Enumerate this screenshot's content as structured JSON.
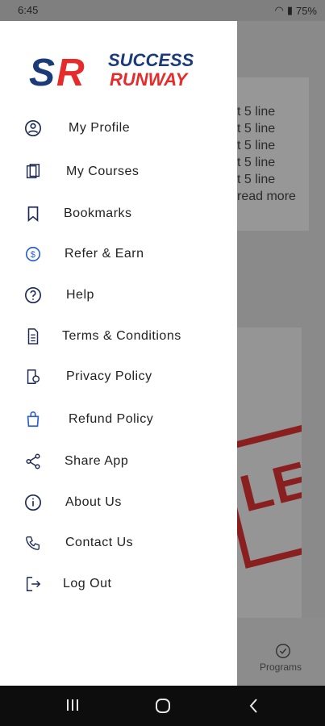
{
  "status": {
    "time": "6:45",
    "battery": "75%"
  },
  "background": {
    "lines": [
      "t 5 line",
      "t 5 line",
      "t 5 line",
      "t 5 line",
      "t 5 line",
      "read more"
    ],
    "poster_text": "LE",
    "tab_label": "Programs"
  },
  "logo": {
    "mark": "SR",
    "line1": "SUCCESS",
    "line2": "RUNWAY"
  },
  "menu": [
    {
      "label": "My Profile",
      "icon": "profile-icon"
    },
    {
      "label": "My Courses",
      "icon": "courses-icon"
    },
    {
      "label": "Bookmarks",
      "icon": "bookmark-icon"
    },
    {
      "label": "Refer & Earn",
      "icon": "refer-icon"
    },
    {
      "label": "Help",
      "icon": "help-icon"
    },
    {
      "label": "Terms & Conditions",
      "icon": "document-icon"
    },
    {
      "label": "Privacy Policy",
      "icon": "privacy-icon"
    },
    {
      "label": "Refund Policy",
      "icon": "bag-icon"
    },
    {
      "label": "Share App",
      "icon": "share-icon"
    },
    {
      "label": "About Us",
      "icon": "info-icon"
    },
    {
      "label": "Contact Us",
      "icon": "phone-icon"
    },
    {
      "label": "Log Out",
      "icon": "logout-icon"
    }
  ],
  "colors": {
    "brand_red": "#e52b2b",
    "brand_blue": "#1b3a7a",
    "icon": "#1e2a55"
  }
}
